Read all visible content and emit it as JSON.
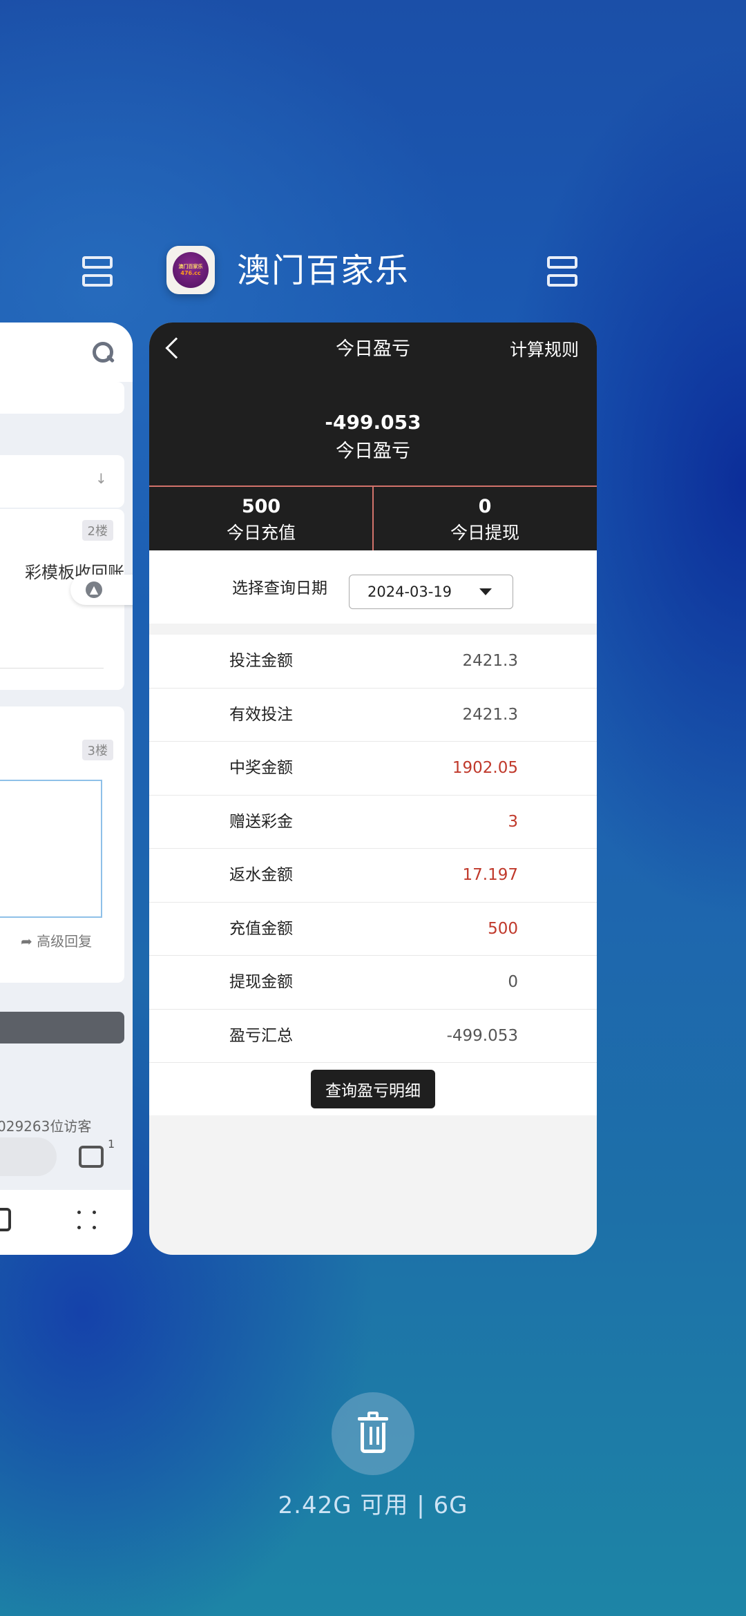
{
  "app": {
    "title": "澳门百家乐",
    "logo_text_1": "澳门百家乐",
    "logo_text_2": "476.cc"
  },
  "left_card": {
    "floor_2": "2楼",
    "floor_3": "3楼",
    "snippet": "彩模板收回账",
    "reply_link": "高级回复",
    "visitors": "029263位访客",
    "msg_badge": "1"
  },
  "page": {
    "title": "今日盈亏",
    "rules_link": "计算规则",
    "amount": "-499.053",
    "amount_label": "今日盈亏",
    "recharge": {
      "value": "500",
      "label": "今日充值"
    },
    "withdraw": {
      "value": "0",
      "label": "今日提现"
    }
  },
  "date_query": {
    "label": "选择查询日期",
    "value": "2024-03-19"
  },
  "rows": [
    {
      "label": "投注金额",
      "value": "2421.3",
      "color": "#555555"
    },
    {
      "label": "有效投注",
      "value": "2421.3",
      "color": "#555555"
    },
    {
      "label": "中奖金额",
      "value": "1902.05",
      "color": "#c0392b"
    },
    {
      "label": "赠送彩金",
      "value": "3",
      "color": "#c0392b"
    },
    {
      "label": "返水金额",
      "value": "17.197",
      "color": "#c0392b"
    },
    {
      "label": "充值金额",
      "value": "500",
      "color": "#c0392b"
    },
    {
      "label": "提现金额",
      "value": "0",
      "color": "#555555"
    },
    {
      "label": "盈亏汇总",
      "value": "-499.053",
      "color": "#555555"
    }
  ],
  "detail_button": "查询盈亏明细",
  "memory": "2.42G 可用 | 6G"
}
